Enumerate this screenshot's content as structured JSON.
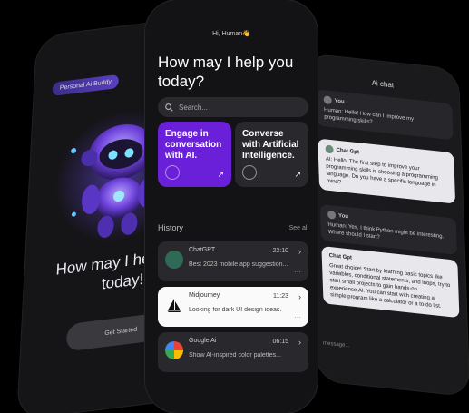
{
  "left_screen": {
    "badge": "Personal Ai Buddy",
    "title": "How may I help you today!",
    "cta": "Get Started"
  },
  "center_screen": {
    "greeting": "Hi, Human👋",
    "headline": "How may I help you today?",
    "search_placeholder": "Search...",
    "cards": [
      {
        "text": "Engage in conversation with AI.",
        "color": "#6a20d8"
      },
      {
        "text": "Converse with Artificial Intelligence.",
        "color": "#29282c"
      }
    ],
    "history_label": "History",
    "see_all": "See all",
    "history": [
      {
        "name": "ChatGPT",
        "time": "22:10",
        "preview": "Best 2023 mobile app suggestion..."
      },
      {
        "name": "Midjourney",
        "time": "11:23",
        "preview": "Looking for dark UI design ideas."
      },
      {
        "name": "Google Ai",
        "time": "06:15",
        "preview": "Show AI-inspired color palettes..."
      }
    ]
  },
  "right_screen": {
    "title": "Ai chat",
    "messages": [
      {
        "author": "You",
        "text": "Human: Hello! How can I improve my programming skills?"
      },
      {
        "author": "Chat Gpt",
        "text": "AI: Hello! The first step to improve your programming skills is choosing a programming language. Do you have a specific language in mind?"
      },
      {
        "author": "You",
        "text": "Human: Yes, I think Python might be interesting. Where should I start?"
      },
      {
        "author": "Chat Gpt",
        "text": "Great choice! Start by learning basic topics like variables, conditional statements, and loops, try to start small projects to gain hands-on experience.AI: You can start with creating a simple program like a calculator or a to-do list."
      }
    ],
    "input_placeholder": "message..."
  }
}
